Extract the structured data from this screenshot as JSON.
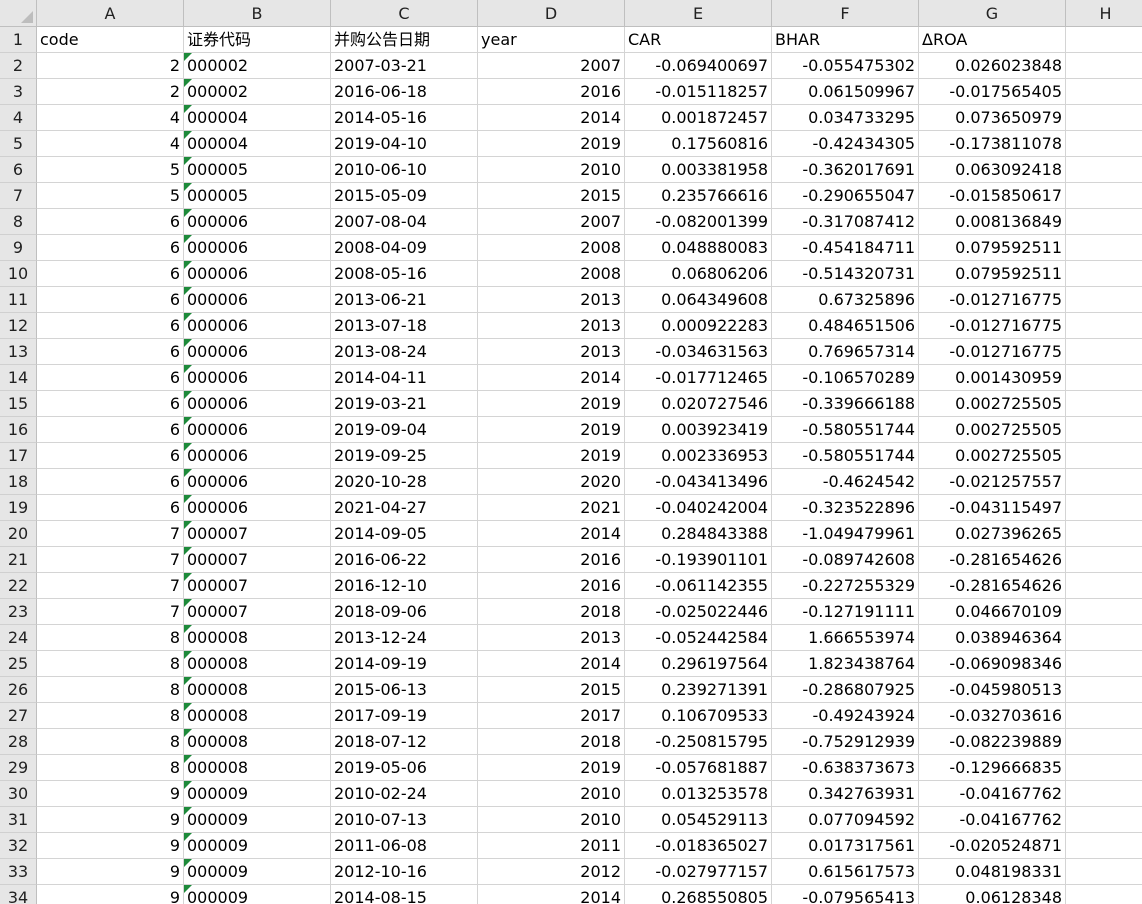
{
  "columns": [
    "A",
    "B",
    "C",
    "D",
    "E",
    "F",
    "G",
    "H"
  ],
  "header_row": [
    "code",
    "证券代码",
    "并购公告日期",
    "year",
    "CAR",
    "BHAR",
    "ΔROA",
    ""
  ],
  "rows": [
    [
      "2",
      "000002",
      "2007-03-21",
      "2007",
      "-0.069400697",
      "-0.055475302",
      "0.026023848"
    ],
    [
      "2",
      "000002",
      "2016-06-18",
      "2016",
      "-0.015118257",
      "0.061509967",
      "-0.017565405"
    ],
    [
      "4",
      "000004",
      "2014-05-16",
      "2014",
      "0.001872457",
      "0.034733295",
      "0.073650979"
    ],
    [
      "4",
      "000004",
      "2019-04-10",
      "2019",
      "0.17560816",
      "-0.42434305",
      "-0.173811078"
    ],
    [
      "5",
      "000005",
      "2010-06-10",
      "2010",
      "0.003381958",
      "-0.362017691",
      "0.063092418"
    ],
    [
      "5",
      "000005",
      "2015-05-09",
      "2015",
      "0.235766616",
      "-0.290655047",
      "-0.015850617"
    ],
    [
      "6",
      "000006",
      "2007-08-04",
      "2007",
      "-0.082001399",
      "-0.317087412",
      "0.008136849"
    ],
    [
      "6",
      "000006",
      "2008-04-09",
      "2008",
      "0.048880083",
      "-0.454184711",
      "0.079592511"
    ],
    [
      "6",
      "000006",
      "2008-05-16",
      "2008",
      "0.06806206",
      "-0.514320731",
      "0.079592511"
    ],
    [
      "6",
      "000006",
      "2013-06-21",
      "2013",
      "0.064349608",
      "0.67325896",
      "-0.012716775"
    ],
    [
      "6",
      "000006",
      "2013-07-18",
      "2013",
      "0.000922283",
      "0.484651506",
      "-0.012716775"
    ],
    [
      "6",
      "000006",
      "2013-08-24",
      "2013",
      "-0.034631563",
      "0.769657314",
      "-0.012716775"
    ],
    [
      "6",
      "000006",
      "2014-04-11",
      "2014",
      "-0.017712465",
      "-0.106570289",
      "0.001430959"
    ],
    [
      "6",
      "000006",
      "2019-03-21",
      "2019",
      "0.020727546",
      "-0.339666188",
      "0.002725505"
    ],
    [
      "6",
      "000006",
      "2019-09-04",
      "2019",
      "0.003923419",
      "-0.580551744",
      "0.002725505"
    ],
    [
      "6",
      "000006",
      "2019-09-25",
      "2019",
      "0.002336953",
      "-0.580551744",
      "0.002725505"
    ],
    [
      "6",
      "000006",
      "2020-10-28",
      "2020",
      "-0.043413496",
      "-0.4624542",
      "-0.021257557"
    ],
    [
      "6",
      "000006",
      "2021-04-27",
      "2021",
      "-0.040242004",
      "-0.323522896",
      "-0.043115497"
    ],
    [
      "7",
      "000007",
      "2014-09-05",
      "2014",
      "0.284843388",
      "-1.049479961",
      "0.027396265"
    ],
    [
      "7",
      "000007",
      "2016-06-22",
      "2016",
      "-0.193901101",
      "-0.089742608",
      "-0.281654626"
    ],
    [
      "7",
      "000007",
      "2016-12-10",
      "2016",
      "-0.061142355",
      "-0.227255329",
      "-0.281654626"
    ],
    [
      "7",
      "000007",
      "2018-09-06",
      "2018",
      "-0.025022446",
      "-0.127191111",
      "0.046670109"
    ],
    [
      "8",
      "000008",
      "2013-12-24",
      "2013",
      "-0.052442584",
      "1.666553974",
      "0.038946364"
    ],
    [
      "8",
      "000008",
      "2014-09-19",
      "2014",
      "0.296197564",
      "1.823438764",
      "-0.069098346"
    ],
    [
      "8",
      "000008",
      "2015-06-13",
      "2015",
      "0.239271391",
      "-0.286807925",
      "-0.045980513"
    ],
    [
      "8",
      "000008",
      "2017-09-19",
      "2017",
      "0.106709533",
      "-0.49243924",
      "-0.032703616"
    ],
    [
      "8",
      "000008",
      "2018-07-12",
      "2018",
      "-0.250815795",
      "-0.752912939",
      "-0.082239889"
    ],
    [
      "8",
      "000008",
      "2019-05-06",
      "2019",
      "-0.057681887",
      "-0.638373673",
      "-0.129666835"
    ],
    [
      "9",
      "000009",
      "2010-02-24",
      "2010",
      "0.013253578",
      "0.342763931",
      "-0.04167762"
    ],
    [
      "9",
      "000009",
      "2010-07-13",
      "2010",
      "0.054529113",
      "0.077094592",
      "-0.04167762"
    ],
    [
      "9",
      "000009",
      "2011-06-08",
      "2011",
      "-0.018365027",
      "0.017317561",
      "-0.020524871"
    ],
    [
      "9",
      "000009",
      "2012-10-16",
      "2012",
      "-0.027977157",
      "0.615617573",
      "0.048198331"
    ],
    [
      "9",
      "000009",
      "2014-08-15",
      "2014",
      "0.268550805",
      "-0.079565413",
      "0.06128348"
    ]
  ],
  "colors": {
    "header_bg": "#e6e6e6",
    "gridline": "#d4d4d4",
    "text_marker": "#1d8a3a"
  }
}
